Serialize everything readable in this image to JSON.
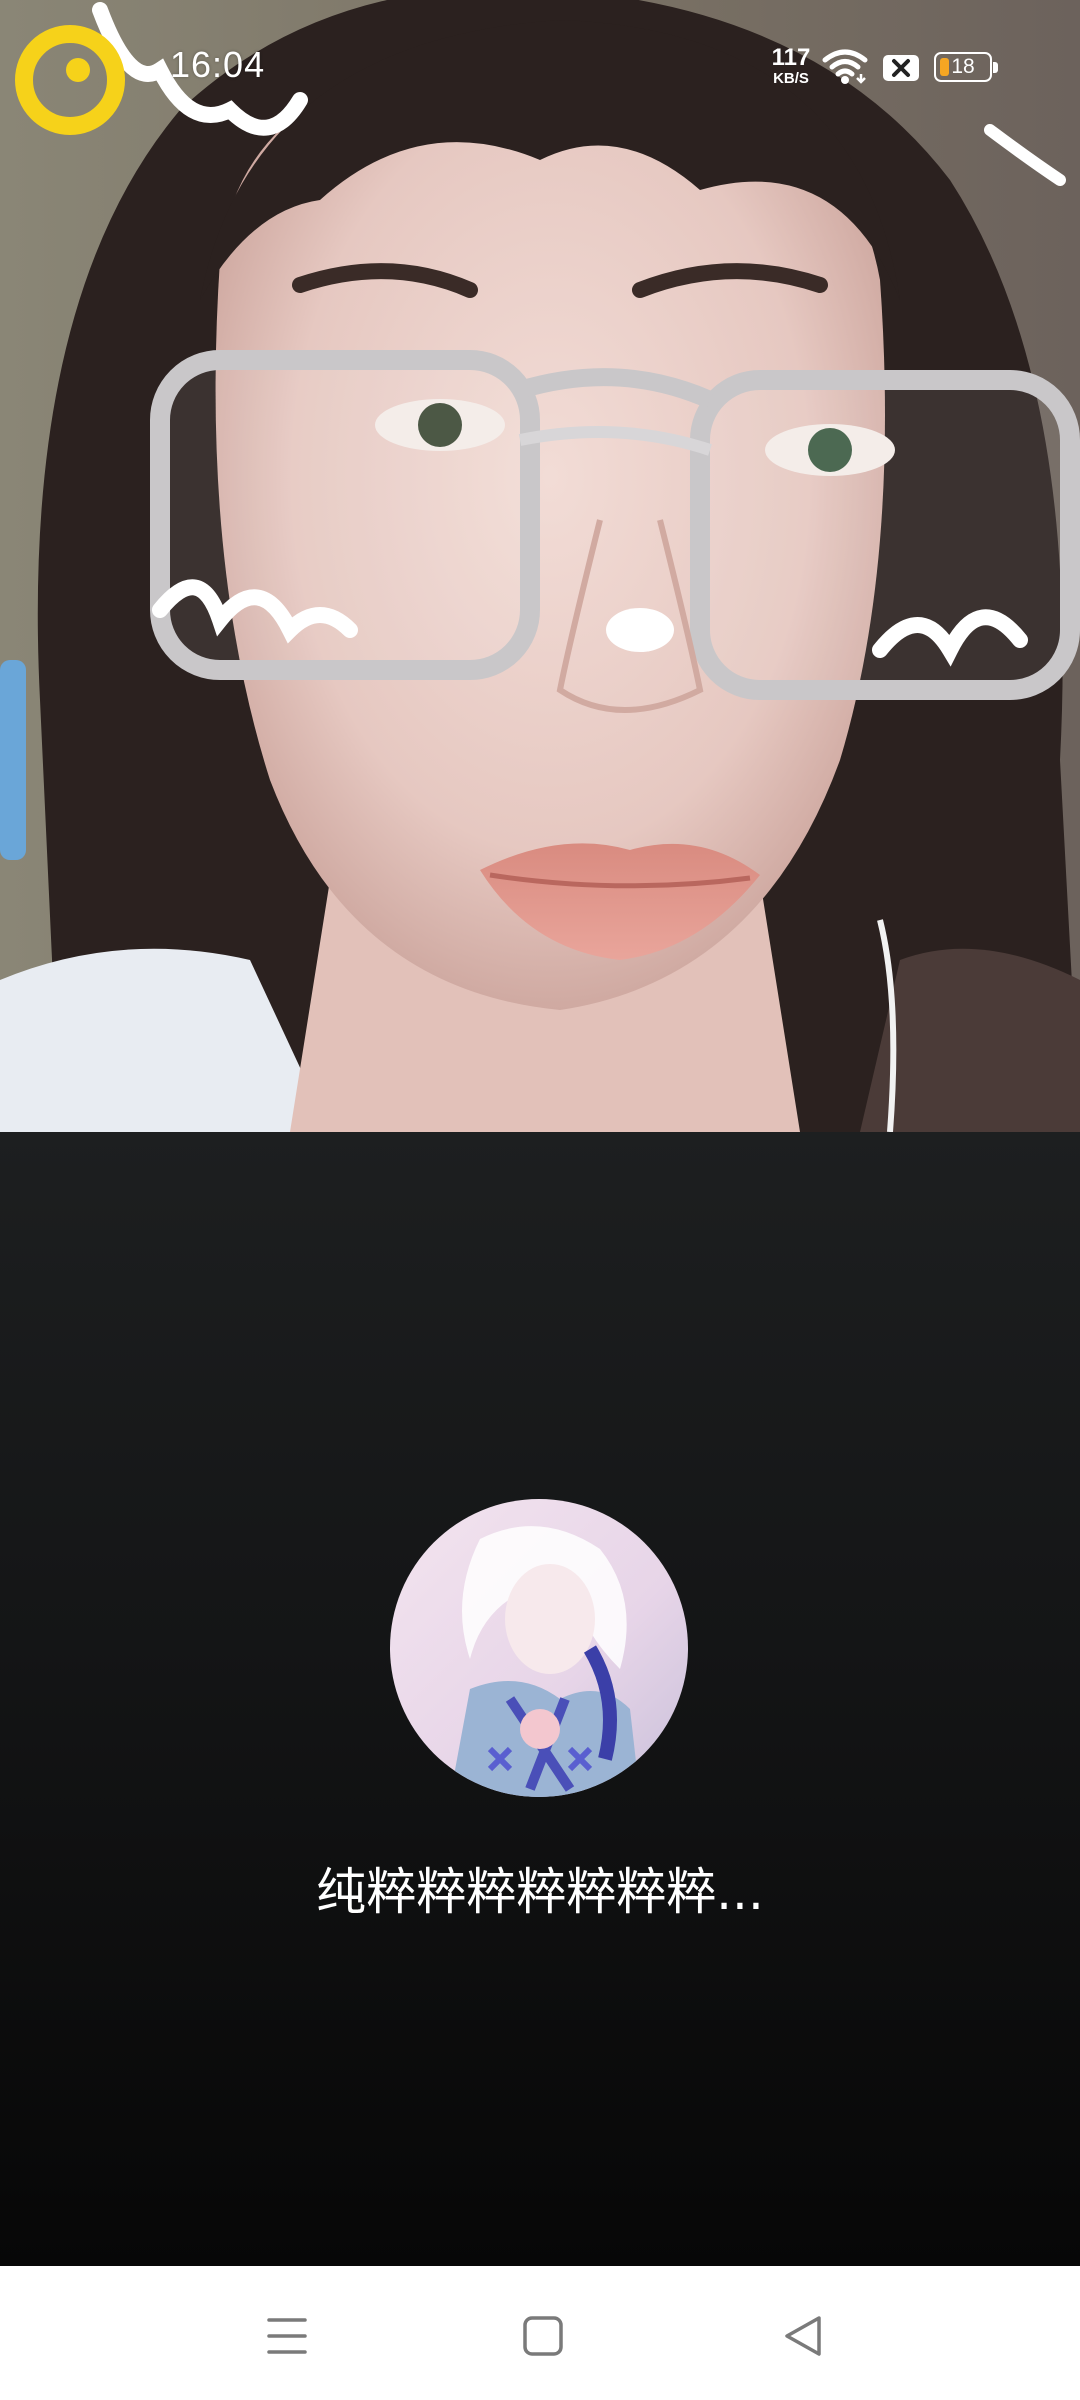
{
  "status_bar": {
    "time": "16:04",
    "net_speed_value": "117",
    "net_speed_unit": "KB/S",
    "wifi_icon": "wifi-icon",
    "sim_icon": "no-sim-icon",
    "battery_level": "18",
    "battery_fraction": 0.18,
    "battery_color": "#f5a623"
  },
  "call": {
    "caller_name": "纯粹粹粹粹粹粹粹...",
    "avatar_icon": "caller-avatar"
  },
  "nav_bar": {
    "menu_icon": "recent-apps-icon",
    "home_icon": "home-icon",
    "back_icon": "back-icon"
  }
}
